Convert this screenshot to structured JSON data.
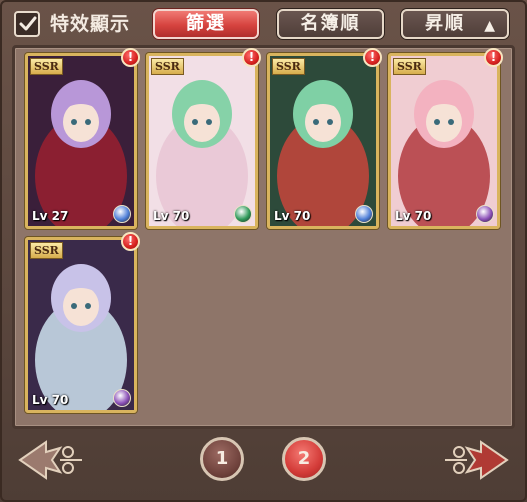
{
  "header": {
    "checkbox_checked": true,
    "checkbox_label": "特效顯示",
    "filter_label": "篩選",
    "sort_name_label": "名簿順",
    "sort_order_label": "昇順",
    "sort_order_arrow": "▲"
  },
  "cards": [
    {
      "rarity": "SSR",
      "level": "Lv 27",
      "element": "water",
      "element_color": "#4f7fd8",
      "new_badge": "!",
      "palette": [
        "#3a1f3a",
        "#9a2030",
        "#b897d8"
      ]
    },
    {
      "rarity": "SSR",
      "level": "Lv 70",
      "element": "wind",
      "element_color": "#2f9a5a",
      "new_badge": "!",
      "palette": [
        "#f2dfe6",
        "#e9c5d3",
        "#86d2a8"
      ]
    },
    {
      "rarity": "SSR",
      "level": "Lv 70",
      "element": "water",
      "element_color": "#4f7fd8",
      "new_badge": "!",
      "palette": [
        "#2d4a3a",
        "#c8453c",
        "#7fd0a5"
      ]
    },
    {
      "rarity": "SSR",
      "level": "Lv 70",
      "element": "dark",
      "element_color": "#8b4fb8",
      "new_badge": "!",
      "palette": [
        "#f0cdd2",
        "#b23a3f",
        "#f3b2c0"
      ]
    },
    {
      "rarity": "SSR",
      "level": "Lv 70",
      "element": "dark",
      "element_color": "#8b4fb8",
      "new_badge": "!",
      "palette": [
        "#3a2a4a",
        "#cfe3f0",
        "#c8c2e8"
      ]
    }
  ],
  "pagination": {
    "pages": [
      "1",
      "2"
    ],
    "current_page": "2",
    "prev_icon": "ornate-left-arrow",
    "next_icon": "ornate-right-arrow"
  }
}
